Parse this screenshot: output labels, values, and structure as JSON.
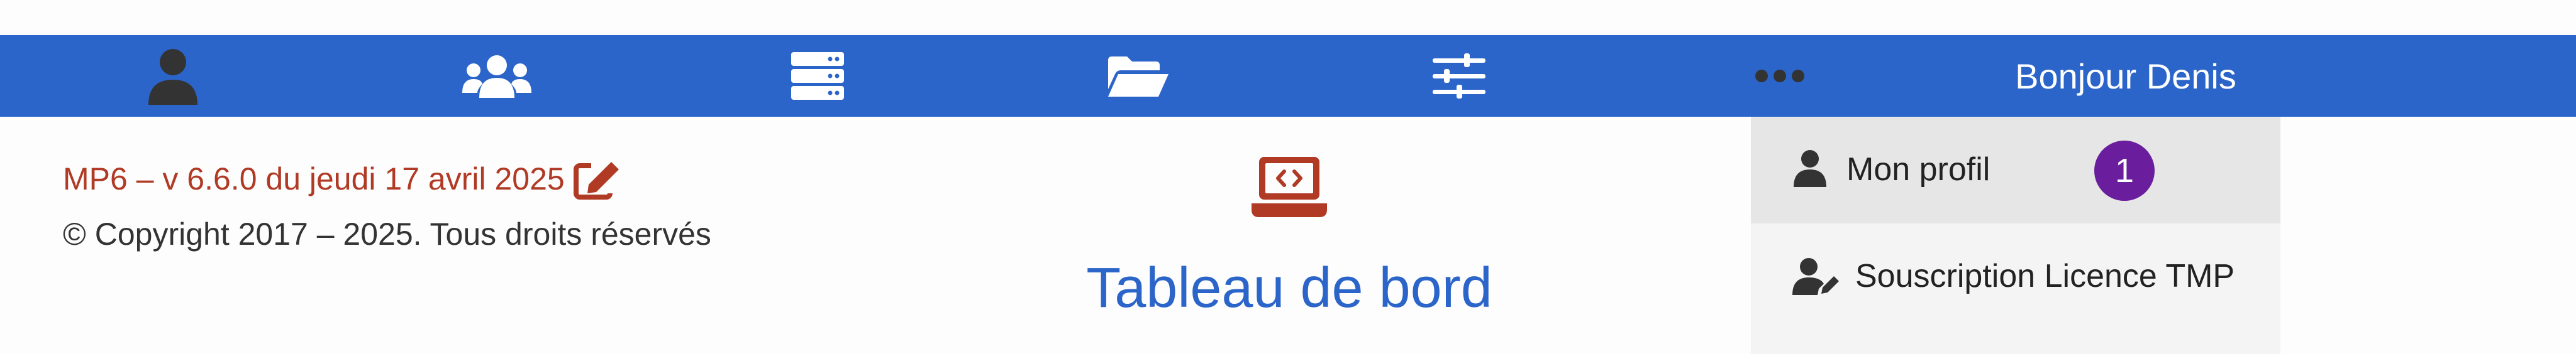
{
  "navbar": {
    "items": [
      {
        "icon": "user-icon"
      },
      {
        "icon": "users-icon"
      },
      {
        "icon": "server-icon"
      },
      {
        "icon": "folder-open-icon"
      },
      {
        "icon": "sliders-icon"
      },
      {
        "icon": "ellipsis-icon"
      }
    ],
    "greeting": "Bonjour Denis"
  },
  "footer_info": {
    "version": "MP6 – v 6.6.0 du jeudi 17 avril 2025",
    "copyright": "© Copyright 2017 – 2025. Tous droits réservés"
  },
  "dashboard": {
    "icon": "laptop-code-icon",
    "title": "Tableau de bord"
  },
  "user_menu": {
    "items": [
      {
        "icon": "user-icon",
        "label": "Mon profil",
        "badge": "1"
      },
      {
        "icon": "user-edit-icon",
        "label": "Souscription Licence TMP"
      }
    ]
  },
  "colors": {
    "navbar": "#2b65c9",
    "version_text": "#b03a24",
    "dashboard_icon": "#b03a24",
    "title": "#2b65c9",
    "badge": "#6a1d9c"
  }
}
